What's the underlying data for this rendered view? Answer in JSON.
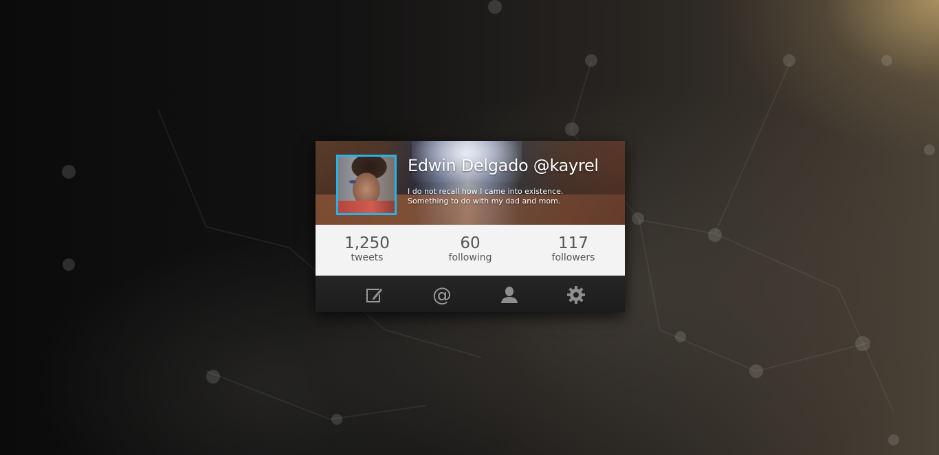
{
  "profile": {
    "name_handle": "Edwin Delgado @kayrel",
    "bio_line_1": "I do not recall how I came into existence.",
    "bio_line_2": "Something to do with my dad and mom.",
    "accent_color": "#27b3ea"
  },
  "stats": [
    {
      "value": "1,250",
      "label": "tweets"
    },
    {
      "value": "60",
      "label": "following"
    },
    {
      "value": "117",
      "label": "followers"
    }
  ],
  "toolbar": {
    "icons": [
      "compose-icon",
      "mention-icon",
      "profile-icon",
      "settings-icon"
    ],
    "mention_glyph": "@"
  }
}
